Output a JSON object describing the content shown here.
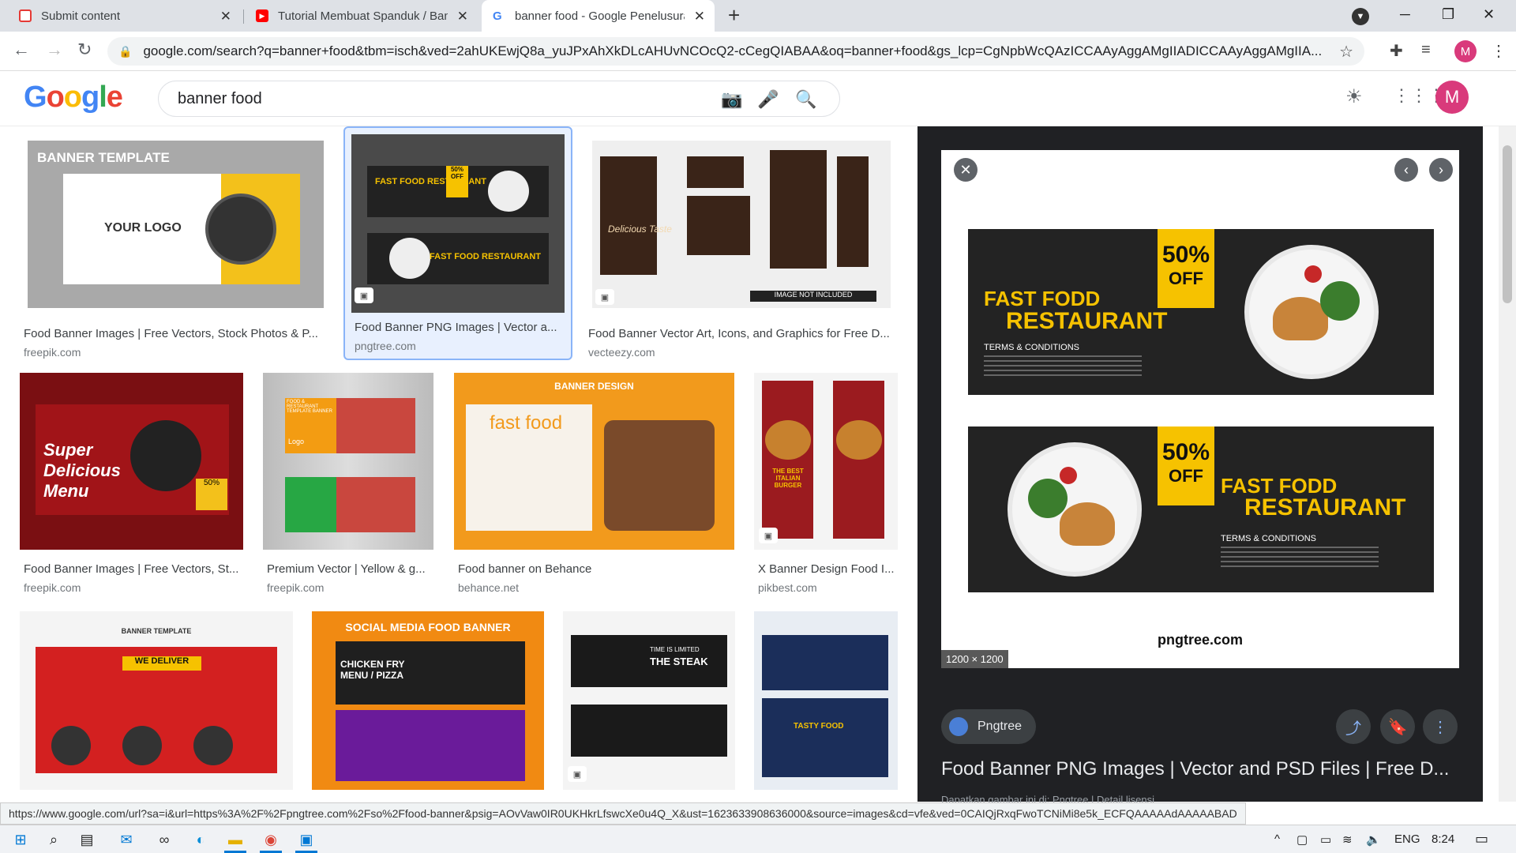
{
  "browser": {
    "tabs": [
      {
        "title": "Submit content",
        "icon": "submit-favicon",
        "color": "#e53935"
      },
      {
        "title": "Tutorial Membuat Spanduk / Ban",
        "icon": "youtube-icon",
        "color": "#ff0000"
      },
      {
        "title": "banner food - Google Penelusura",
        "icon": "google-g-icon",
        "color": "#4285f4"
      }
    ],
    "url": "google.com/search?q=banner+food&tbm=isch&ved=2ahUKEwjQ8a_yuJPxAhXkDLcAHUvNCOcQ2-cCegQIABAA&oq=banner+food&gs_lcp=CgNpbWcQAzICCAAyAggAMgIIADICCAAyAggAMgIIA...",
    "profile_initial": "M"
  },
  "google": {
    "logo": "Google",
    "query": "banner food",
    "profile_initial": "M"
  },
  "results": [
    {
      "thumb_title": "BANNER TEMPLATE",
      "thumb_sub": "YOUR LOGO",
      "caption": "Food Banner Images | Free Vectors, Stock Photos & P...",
      "domain": "freepik.com"
    },
    {
      "thumb_title": "FAST FOOD RESTAURANT",
      "thumb_sub": "50% OFF",
      "caption": "Food Banner PNG Images | Vector a...",
      "domain": "pngtree.com"
    },
    {
      "thumb_title": "Delicious Taste",
      "thumb_sub": "IMAGE NOT INCLUDED",
      "caption": "Food Banner Vector Art, Icons, and Graphics for Free D...",
      "domain": "vecteezy.com"
    },
    {
      "thumb_title": "Super Delicious Menu",
      "thumb_sub": "50%",
      "caption": "Food Banner Images | Free Vectors, St...",
      "domain": "freepik.com"
    },
    {
      "thumb_title": "FOOD & RESTAURANT TEMPLATE BANNER",
      "thumb_sub": "Logo",
      "caption": "Premium Vector | Yellow & g...",
      "domain": "freepik.com"
    },
    {
      "thumb_title": "BANNER DESIGN",
      "thumb_sub": "fast food",
      "caption": "Food banner on Behance",
      "domain": "behance.net"
    },
    {
      "thumb_title": "THE BEST ITALIAN BURGER",
      "thumb_sub": "",
      "caption": "X Banner Design Food I...",
      "domain": "pikbest.com"
    },
    {
      "thumb_title": "BANNER TEMPLATE",
      "thumb_sub": "WE DELIVER",
      "caption": "",
      "domain": ""
    },
    {
      "thumb_title": "SOCIAL MEDIA FOOD BANNER",
      "thumb_sub": "CHICKEN FRY MENU / PIZZA",
      "caption": "",
      "domain": ""
    },
    {
      "thumb_title": "THE STEAK",
      "thumb_sub": "TIME IS LIMITED",
      "caption": "",
      "domain": ""
    },
    {
      "thumb_title": "TASTY FOOD",
      "thumb_sub": "",
      "caption": "",
      "domain": ""
    }
  ],
  "preview": {
    "banner_title_1": "FAST FODD",
    "banner_title_2": "RESTAURANT",
    "discount_big": "50%",
    "discount_small": "OFF",
    "terms": "TERMS & CONDITIONS",
    "watermark": "pngtree.com",
    "size": "1200 × 1200",
    "source": "Pngtree",
    "heading": "Food Banner PNG Images | Vector and PSD Files | Free D...",
    "sub": "Dapatkan gambar ini di: Pngtree | Detail lisensi"
  },
  "status_url": "https://www.google.com/url?sa=i&url=https%3A%2F%2Fpngtree.com%2Fso%2Ffood-banner&psig=AOvVaw0IR0UKHkrLfswcXe0u4Q_X&ust=1623633908636000&source=images&cd=vfe&ved=0CAIQjRxqFwoTCNiMi8e5k_ECFQAAAAAdAAAAABAD",
  "taskbar": {
    "language": "ENG",
    "time": "8:24"
  }
}
